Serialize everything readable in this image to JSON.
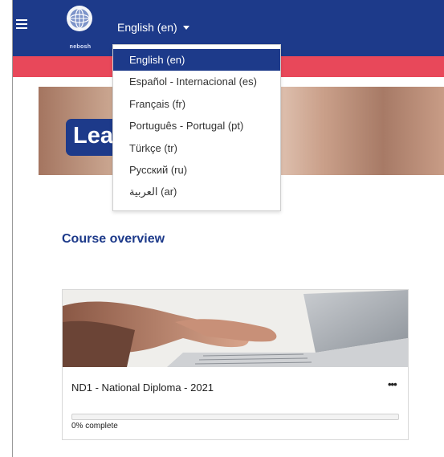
{
  "navbar": {
    "brand_name": "nebosh",
    "language_toggle_label": "English (en)"
  },
  "language_menu": {
    "items": [
      {
        "label": "English (en)",
        "active": true
      },
      {
        "label": "Español - Internacional (es)",
        "active": false
      },
      {
        "label": "Français (fr)",
        "active": false
      },
      {
        "label": "Português - Portugal (pt)",
        "active": false
      },
      {
        "label": "Türkçe (tr)",
        "active": false
      },
      {
        "label": "Русский (ru)",
        "active": false
      },
      {
        "label": "العربية (ar)",
        "active": false
      }
    ]
  },
  "hero": {
    "title_visible": "Lea"
  },
  "main": {
    "section_title": "Course overview",
    "course_card": {
      "title": "ND1 - National Diploma - 2021",
      "menu_icon": "more-horizontal-icon",
      "progress_percent": 0,
      "progress_label": "0% complete"
    }
  },
  "colors": {
    "navbar": "#1d3a8a",
    "accent_strip": "#e8485a",
    "heading": "#1d3a8a"
  }
}
